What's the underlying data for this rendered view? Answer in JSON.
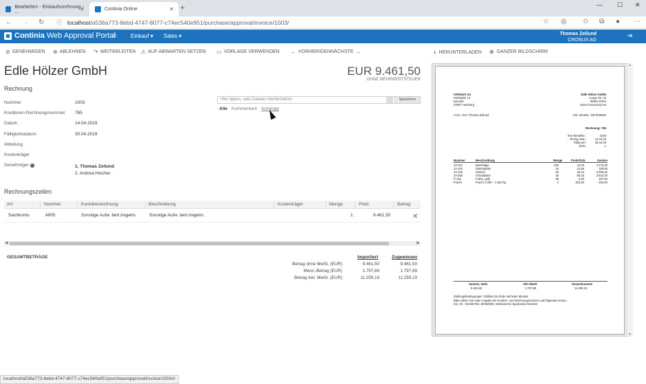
{
  "browser": {
    "tabs": [
      {
        "label": "Bearbeiten - Einkaufsrechnung - ...",
        "active": false
      },
      {
        "label": "Continia Online",
        "active": true
      }
    ],
    "url_host": "localhost",
    "url_path": "/a536a773-8ebd-4747-8077-c74ec540e951/purchase/approval/invoice/1003/",
    "status_url": "localhost/a536a773-8ebd-4747-8077-c74ec540e951/purchase/approval/invoice/1003/#"
  },
  "header": {
    "brand": "Continia",
    "brand_sub": "Web Approval Portal",
    "nav": [
      {
        "label": "Einkauf ▾"
      },
      {
        "label": "Sales ▾"
      }
    ],
    "user_name": "Thomas Zeilund",
    "user_company": "CRONUS AG",
    "accent": "#1e73be"
  },
  "toolbar": {
    "approve": "GENEHMIGEN",
    "reject": "ABLEHNEN",
    "forward": "WEITERLEITEN",
    "onhold": "AUF ABWARTEN SETZEN",
    "template": "VORLAGE VERWENDEN",
    "previous": "VORHERIGEN",
    "next": "NÄCHSTE",
    "download": "HERUNTERLADEN",
    "fullscreen": "GANZER BILDSCHIRM"
  },
  "invoice": {
    "vendor": "Edle Hölzer GmbH",
    "amount": "EUR 9.461,50",
    "amount_note": "OHNE MEHRWERTSTEUER",
    "section": "Rechnung",
    "fields": [
      {
        "label": "Nummer",
        "value": "1003"
      },
      {
        "label": "Kreditoren Rechnungsnummer",
        "value": "765"
      },
      {
        "label": "Datum",
        "value": "14.04.2019"
      },
      {
        "label": "Fälligkeitsdatum",
        "value": "30.04.2019"
      },
      {
        "label": "Abteilung",
        "value": ""
      },
      {
        "label": "Kostenträger",
        "value": ""
      },
      {
        "label": "Genehmiger",
        "value": ""
      }
    ],
    "approvers": [
      "1. Thomas Zeilund",
      "2. Andrea Hischer"
    ]
  },
  "comments": {
    "placeholder": "Hier tippen, oder Dateien hierhinziehen",
    "save": "Speichern",
    "tabs": {
      "all": "Alle",
      "comments": "Kommentare",
      "attachments": "Anhänge"
    }
  },
  "lines": {
    "title": "Rechnungszeilen",
    "columns": [
      "Art",
      "Nummer",
      "Kontobezeichnung",
      "Beschreibung",
      "Kostenträger",
      "Menge",
      "Preis",
      "Betrag"
    ],
    "rows": [
      {
        "art": "Sachkonto",
        "nummer": "4905",
        "konto": "Sonstige Aufw. betr./regelm.",
        "beschreibung": "Sonstige Aufw. betr./regelm.",
        "kostentraeger": "",
        "menge": "1",
        "preis": "9.461,50",
        "betrag": ""
      }
    ]
  },
  "totals": {
    "title": "GESAMTBETRÄGE",
    "col_imported": "Importiert",
    "col_assigned": "Zugewiesen",
    "rows": [
      {
        "label": "Betrag ohne MwSt. (EUR)",
        "imported": "9.461,50",
        "assigned": "9.461,50"
      },
      {
        "label": "Mwst.-Betrag (EUR)",
        "imported": "1.797,69",
        "assigned": "1.797,69"
      },
      {
        "label": "Betrag inkl. MwSt. (EUR)",
        "imported": "11.259,19",
        "assigned": "11.259,19"
      }
    ]
  },
  "document": {
    "recipient": [
      "CRONUS AG",
      "Hofstraße 12",
      "Bonrath",
      "20097 Hamburg"
    ],
    "attn": "z.Hd.: Herr Thomas Zeilund",
    "sender": [
      "Edle Hölzer GmbH",
      "Lange Str. 22",
      "99081 Erfurt",
      "www.cronuscorp.net"
    ],
    "vat": "USt.-IdentNr.: DE7528460",
    "doc_title": "Rechnung: 765",
    "meta": [
      {
        "k": "Ihre Bestellnr.:",
        "v": "1003"
      },
      {
        "k": "Rechg.-Dat.:",
        "v": "14.04.19"
      },
      {
        "k": "Fällig am:",
        "v": "30.04.19"
      },
      {
        "k": "Seite:",
        "v": "1"
      }
    ],
    "item_cols": [
      "Nummer",
      "Beschreibung",
      "Menge",
      "Preis/Stck.",
      "Summe"
    ],
    "items": [
      {
        "n": "10-110",
        "d": "Beschläge",
        "m": "250",
        "p": "10,20",
        "s": "2.375,00"
      },
      {
        "n": "10-104",
        "d": "Dielenplatte",
        "m": "15",
        "p": "22,65",
        "s": "339,80"
      },
      {
        "n": "10-106",
        "d": "Holzleir",
        "m": "50",
        "p": "40,10",
        "s": "2.005,00"
      },
      {
        "n": "10-308",
        "d": "Schubkästn",
        "m": "45",
        "p": "85,40",
        "s": "3.843,00"
      },
      {
        "n": "P-102",
        "d": "Farbe, gelb",
        "m": "85",
        "p": "2,20",
        "s": "187,00"
      },
      {
        "n": "Fracht",
        "d": "Fracht 1.000 – 1.500 kg",
        "m": "1",
        "p": "462,50",
        "s": "462,50"
      }
    ],
    "sum_cols": [
      "Summe, netto",
      "19% MwSt",
      "Gesamtsumme"
    ],
    "sum_vals": [
      "9.461,50",
      "1.797,69",
      "11.259,19"
    ],
    "footer": [
      "Zahlungsbedingungen: Zahlbar bis Ende nächsten Monats",
      "Bitte zahlen Sie unter Angabe der Kunden- und Rechnungsnummer auf folgendes Konto:",
      "Kto.-Nr.: 941663782, 80050000, Ostdeutsche Sparkasse Dresden"
    ]
  }
}
